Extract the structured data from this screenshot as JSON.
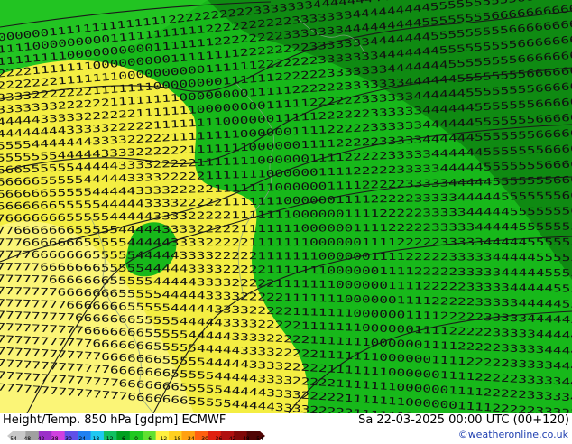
{
  "title_left": "Height/Temp. 850 hPa [gdpm] ECMWF",
  "title_right": "Sa 22-03-2025 00:00 UTC (00+120)",
  "credit": "©weatheronline.co.uk",
  "colorbar": {
    "ticks": [
      "-54",
      "-48",
      "-42",
      "-38",
      "-30",
      "-24",
      "-18",
      "-12",
      "-6",
      "0",
      "6",
      "12",
      "18",
      "24",
      "30",
      "36",
      "42",
      "48",
      "54"
    ],
    "colors": [
      "#c8c8c8",
      "#a0a0a0",
      "#9b30c8",
      "#d040e0",
      "#6050e8",
      "#2080f0",
      "#20c8f0",
      "#10c060",
      "#00a020",
      "#20c820",
      "#60e030",
      "#fff040",
      "#ffd020",
      "#ffa010",
      "#ff6010",
      "#e02010",
      "#b01010",
      "#800808",
      "#500404"
    ]
  },
  "map": {
    "colors": {
      "green_dark": "#0f8a12",
      "green": "#17b81a",
      "green_light": "#22c422",
      "yellow": "#f4ee42",
      "yellow_light": "#fbf680",
      "contour": "#1a1a1a"
    },
    "digit_rows": [
      "00000011111111111111222222222233333334444444444444455555555556666666",
      "1111000000000111111111112222222222333333344444444455555555556666666",
      "1111111100000000001111111222222223333333444444444555555556666666666",
      "2222111111100000000011111111222222223333333444444455555555566666666",
      "2222222111111100000000001111112222222333333344444445555555556666666",
      "3333222222211111110000000011111122222233333334444444555555556666666",
      "3333333222222111111110000000011111222222333333344444455555555666666",
      "4444433333222222111111100000000111112222223333334444445555555566666",
      "4444444433333222221111111100000011111222222333333444444555555566666",
      "5555444444433332222211111111000000111122222333333444444555555566666",
      "5555555444443333222222111111100000011112222233333444444555555566666",
      "6665555554444433332222211111110000001111222223333344444455555556666",
      "6666655555444443333222221111111000000111122222333334444455555556666",
      "6666665555544444333322222111111100000011112222233333444445555555666",
      "6666666555554444433332222211111110000001111222223333344444555555566",
      "7666666655555444443333222221111111000000111122222333334444455555556",
      "7766666665555544444333322222111111100000011112222233333444445555555",
      "7776666666555554444433332222211111110000001111222223333344444555555",
      "7777666666655555444443333222221111111000000111122222333334444455555",
      "7777766666665555544444333322222111111100000011112222233333444445555",
      "7777776666666555554444433332222211111110000001111222223333344444555",
      "7777777666666655555444443333222221111111000000111122222333334444455",
      "7777777766666665555544444333322222111111100000011112222233333444445",
      "7777777776666666555554444433332222211111110000001111222223333344444",
      "7777777777666666655555444443333222221111111000000111122222333334444",
      "7777777777766666665555544444333322222111111100000011112222233333444",
      "7777777777776666666555554444433332222211111110000001111222223333344",
      "7777777777777666666655555444443333222221111111000000111122222333334",
      "7777777777777766666665555544444333322222111111100000011112222233333",
      "7777777777777776666666555554444433332222211111110000001111222223333"
    ]
  }
}
